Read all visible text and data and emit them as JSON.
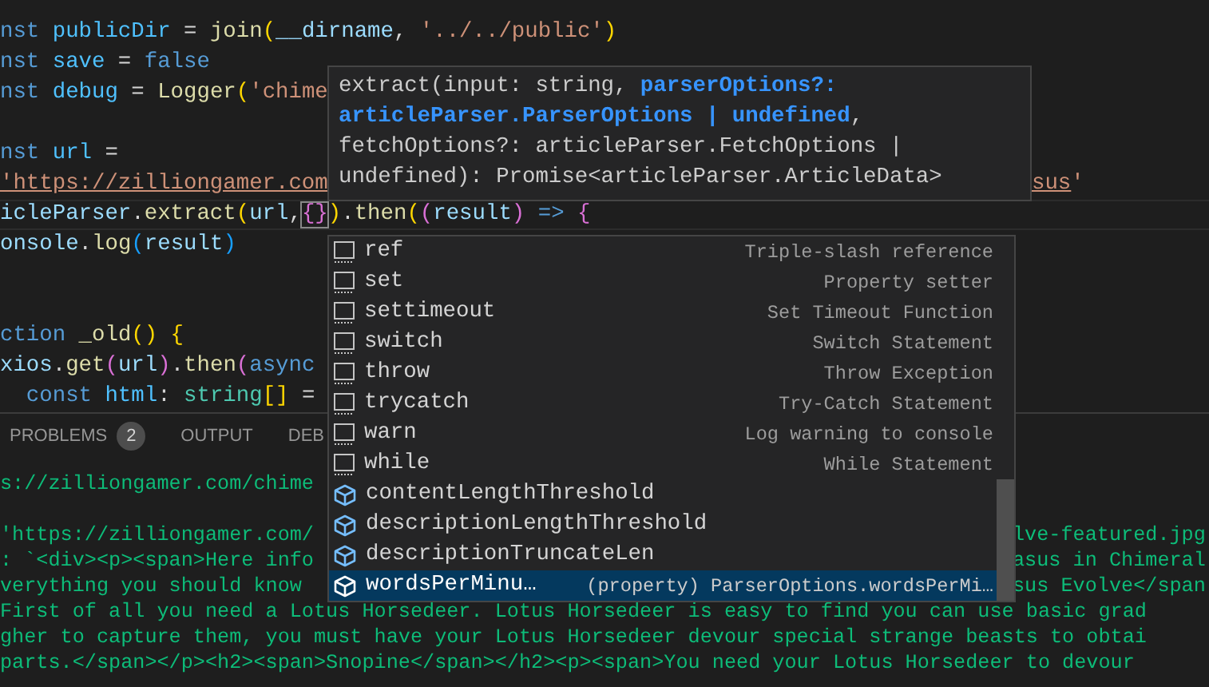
{
  "editor": {
    "lines": [
      {
        "kind": "code",
        "current": false,
        "tokens": [
          {
            "kind": "kw",
            "text": "nst "
          },
          {
            "kind": "const",
            "text": "publicDir"
          },
          {
            "kind": "plain",
            "text": " = "
          },
          {
            "kind": "fn",
            "text": "join"
          },
          {
            "kind": "br1",
            "text": "("
          },
          {
            "kind": "var",
            "text": "__dirname"
          },
          {
            "kind": "plain",
            "text": ", "
          },
          {
            "kind": "str",
            "text": "'../../public'"
          },
          {
            "kind": "br1",
            "text": ")"
          }
        ]
      },
      {
        "kind": "code",
        "current": false,
        "tokens": [
          {
            "kind": "kw",
            "text": "nst "
          },
          {
            "kind": "const",
            "text": "save"
          },
          {
            "kind": "plain",
            "text": " = "
          },
          {
            "kind": "kw",
            "text": "false"
          }
        ]
      },
      {
        "kind": "code",
        "current": false,
        "tokens": [
          {
            "kind": "kw",
            "text": "nst "
          },
          {
            "kind": "const",
            "text": "debug"
          },
          {
            "kind": "plain",
            "text": " = "
          },
          {
            "kind": "fn",
            "text": "Logger"
          },
          {
            "kind": "br1",
            "text": "("
          },
          {
            "kind": "str",
            "text": "'chime"
          }
        ]
      },
      {
        "kind": "blank"
      },
      {
        "kind": "code",
        "current": false,
        "tokens": [
          {
            "kind": "kw",
            "text": "nst "
          },
          {
            "kind": "const",
            "text": "url"
          },
          {
            "kind": "plain",
            "text": " ="
          }
        ]
      },
      {
        "kind": "code",
        "current": false,
        "tokens": [
          {
            "kind": "link",
            "text": "'https://zilliongamer.com"
          }
        ],
        "tail": [
          {
            "kind": "link",
            "text": "sus"
          },
          {
            "kind": "str",
            "text": "'"
          }
        ]
      },
      {
        "kind": "code",
        "current": true,
        "tokens": [
          {
            "kind": "var",
            "text": "icleParser"
          },
          {
            "kind": "plain",
            "text": "."
          },
          {
            "kind": "fn",
            "text": "extract"
          },
          {
            "kind": "br1",
            "text": "("
          },
          {
            "kind": "var",
            "text": "url"
          },
          {
            "kind": "plain",
            "text": ","
          },
          {
            "kind": "match",
            "text": "{}"
          },
          {
            "kind": "br1",
            "text": ")"
          },
          {
            "kind": "plain",
            "text": "."
          },
          {
            "kind": "fn",
            "text": "then"
          },
          {
            "kind": "br1",
            "text": "("
          },
          {
            "kind": "br2",
            "text": "("
          },
          {
            "kind": "var",
            "text": "result"
          },
          {
            "kind": "br2",
            "text": ")"
          },
          {
            "kind": "kw",
            "text": " => "
          },
          {
            "kind": "br2",
            "text": "{"
          }
        ]
      },
      {
        "kind": "code",
        "current": false,
        "tokens": [
          {
            "kind": "var",
            "text": "onsole"
          },
          {
            "kind": "plain",
            "text": "."
          },
          {
            "kind": "fn",
            "text": "log"
          },
          {
            "kind": "br3",
            "text": "("
          },
          {
            "kind": "var",
            "text": "result"
          },
          {
            "kind": "br3",
            "text": ")"
          }
        ]
      },
      {
        "kind": "blank"
      },
      {
        "kind": "blank"
      },
      {
        "kind": "code",
        "current": false,
        "tokens": [
          {
            "kind": "kw",
            "text": "ction "
          },
          {
            "kind": "fn",
            "text": "_old"
          },
          {
            "kind": "br1",
            "text": "() {"
          }
        ]
      },
      {
        "kind": "code",
        "current": false,
        "tokens": [
          {
            "kind": "var",
            "text": "xios"
          },
          {
            "kind": "plain",
            "text": "."
          },
          {
            "kind": "fn",
            "text": "get"
          },
          {
            "kind": "br2",
            "text": "("
          },
          {
            "kind": "var",
            "text": "url"
          },
          {
            "kind": "br2",
            "text": ")"
          },
          {
            "kind": "plain",
            "text": "."
          },
          {
            "kind": "fn",
            "text": "then"
          },
          {
            "kind": "br2",
            "text": "("
          },
          {
            "kind": "kw",
            "text": "async"
          }
        ]
      },
      {
        "kind": "code",
        "current": false,
        "tokens": [
          {
            "kind": "kw",
            "text": "  const "
          },
          {
            "kind": "const",
            "text": "html"
          },
          {
            "kind": "plain",
            "text": ": "
          },
          {
            "kind": "type",
            "text": "string"
          },
          {
            "kind": "br1",
            "text": "[]"
          },
          {
            "kind": "plain",
            "text": " ="
          }
        ]
      }
    ]
  },
  "hover": {
    "signature": "extract(input: string, **parserOptions?: articleParser.ParserOptions | undefined**, fetchOptions?: articleParser.FetchOptions | undefined): Promise<articleParser.ArticleData>"
  },
  "suggest": {
    "items": [
      {
        "kind": "snippet",
        "label": "ref",
        "detail": "Triple-slash reference",
        "selected": false
      },
      {
        "kind": "snippet",
        "label": "set",
        "detail": "Property setter",
        "selected": false
      },
      {
        "kind": "snippet",
        "label": "settimeout",
        "detail": "Set Timeout Function",
        "selected": false
      },
      {
        "kind": "snippet",
        "label": "switch",
        "detail": "Switch Statement",
        "selected": false
      },
      {
        "kind": "snippet",
        "label": "throw",
        "detail": "Throw Exception",
        "selected": false
      },
      {
        "kind": "snippet",
        "label": "trycatch",
        "detail": "Try-Catch Statement",
        "selected": false
      },
      {
        "kind": "snippet",
        "label": "warn",
        "detail": "Log warning to console",
        "selected": false
      },
      {
        "kind": "snippet",
        "label": "while",
        "detail": "While Statement",
        "selected": false
      },
      {
        "kind": "property",
        "label": "contentLengthThreshold",
        "selected": false
      },
      {
        "kind": "property",
        "label": "descriptionLengthThreshold",
        "selected": false
      },
      {
        "kind": "property",
        "label": "descriptionTruncateLen",
        "selected": false
      },
      {
        "kind": "property",
        "label": "wordsPerMinu…",
        "detail": "(property) ParserOptions.wordsPerMi…",
        "selected": true
      }
    ]
  },
  "panel": {
    "tabs": [
      {
        "label": "PROBLEMS",
        "badge": "2",
        "selected": false
      },
      {
        "label": "OUTPUT",
        "selected": false
      },
      {
        "label": "DEB",
        "selected": false
      }
    ],
    "terminal": [
      {
        "kind": "output",
        "text": "s://zilliongamer.com/chime"
      },
      {
        "kind": "blank"
      },
      {
        "kind": "output",
        "text": "'https://zilliongamer.com/",
        "tail": "lve-featured.jpg"
      },
      {
        "kind": "output",
        "text": ": `<div><p><span>Here info",
        "tail": "asus in Chimeral"
      },
      {
        "kind": "output",
        "text": "verything you should know",
        "tail": "sus Evolve</span"
      },
      {
        "kind": "output",
        "text": "First of all you need a Lotus Horsedeer. Lotus Horsedeer is easy to find you can use basic grad"
      },
      {
        "kind": "output",
        "text": "gher to capture them, you must have your Lotus Horsedeer devour special strange beasts to obtai"
      },
      {
        "kind": "output",
        "text": "parts.</span></p><h2><span>Snopine</span></h2><p><span>You need your Lotus Horsedeer to devour"
      }
    ]
  }
}
